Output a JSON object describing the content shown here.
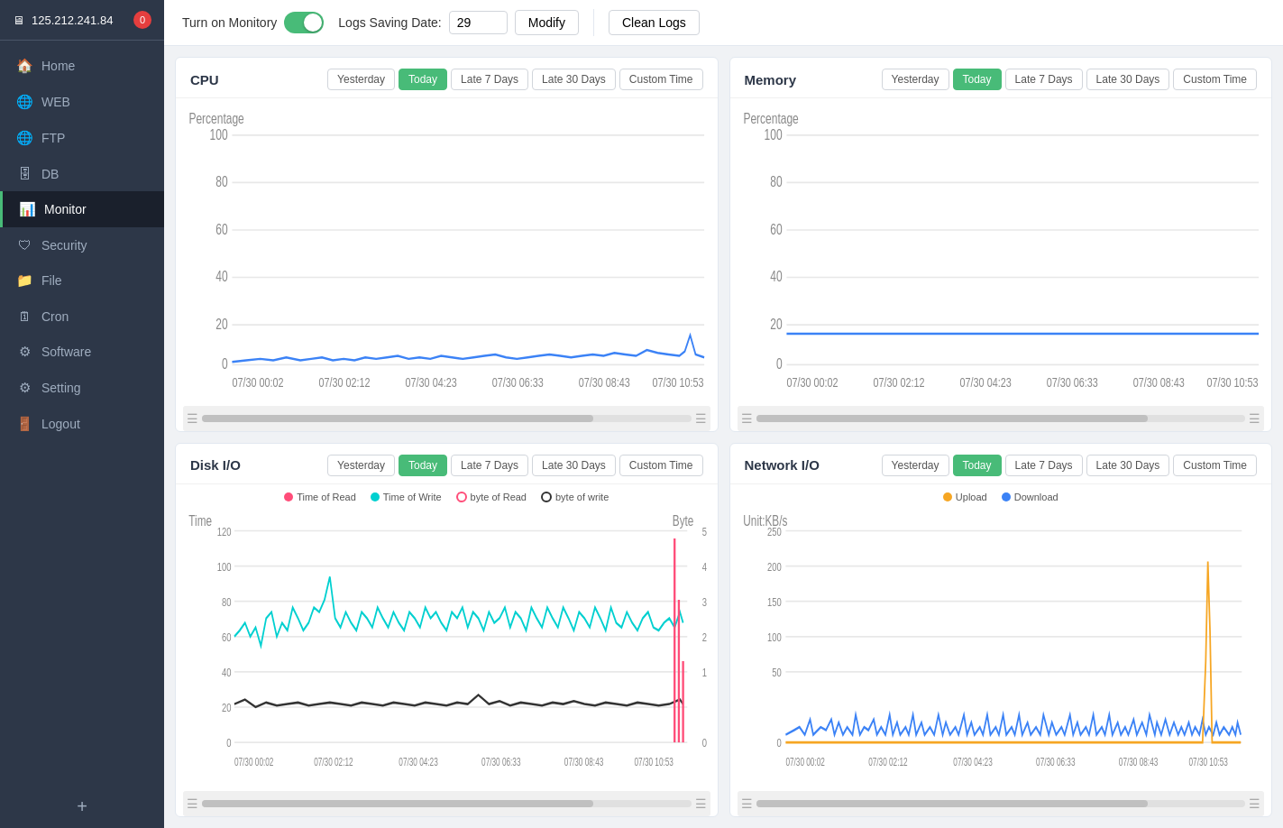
{
  "sidebar": {
    "ip": "125.212.241.84",
    "badge": "0",
    "items": [
      {
        "label": "Home",
        "icon": "🏠",
        "id": "home"
      },
      {
        "label": "WEB",
        "icon": "🌐",
        "id": "web"
      },
      {
        "label": "FTP",
        "icon": "🌐",
        "id": "ftp"
      },
      {
        "label": "DB",
        "icon": "🗄️",
        "id": "db"
      },
      {
        "label": "Monitor",
        "icon": "📊",
        "id": "monitor",
        "active": true
      },
      {
        "label": "Security",
        "icon": "🛡️",
        "id": "security"
      },
      {
        "label": "File",
        "icon": "📁",
        "id": "file"
      },
      {
        "label": "Cron",
        "icon": "🗓️",
        "id": "cron"
      },
      {
        "label": "Software",
        "icon": "⚙️",
        "id": "software"
      },
      {
        "label": "Setting",
        "icon": "⚙️",
        "id": "setting"
      },
      {
        "label": "Logout",
        "icon": "🚪",
        "id": "logout"
      }
    ]
  },
  "topbar": {
    "monitor_label": "Turn on Monitory",
    "logs_saving_label": "Logs Saving Date:",
    "logs_saving_value": "29",
    "modify_label": "Modify",
    "clean_logs_label": "Clean Logs"
  },
  "time_filters": [
    "Yesterday",
    "Today",
    "Late 7 Days",
    "Late 30 Days",
    "Custom Time"
  ],
  "panels": {
    "cpu": {
      "title": "CPU",
      "active_filter": "Today",
      "y_label": "Percentage",
      "y_ticks": [
        "100",
        "80",
        "60",
        "40",
        "20",
        "0"
      ],
      "x_ticks": [
        "07/30 00:02",
        "07/30 02:12",
        "07/30 04:23",
        "07/30 06:33",
        "07/30 08:43",
        "07/30 10:53"
      ]
    },
    "memory": {
      "title": "Memory",
      "active_filter": "Today",
      "y_label": "Percentage",
      "y_ticks": [
        "100",
        "80",
        "60",
        "40",
        "20",
        "0"
      ],
      "x_ticks": [
        "07/30 00:02",
        "07/30 02:12",
        "07/30 04:23",
        "07/30 06:33",
        "07/30 08:43",
        "07/30 10:53"
      ]
    },
    "disk": {
      "title": "Disk I/O",
      "active_filter": "Today",
      "y_label": "Time",
      "y2_label": "Byte",
      "y_ticks": [
        "120",
        "100",
        "80",
        "60",
        "40",
        "20",
        "0"
      ],
      "y2_ticks": [
        "5",
        "4",
        "3",
        "2",
        "1",
        "0"
      ],
      "x_ticks": [
        "07/30 00:02",
        "07/30 02:12",
        "07/30 04:23",
        "07/30 06:33",
        "07/30 08:43",
        "07/30 10:53"
      ],
      "legend": [
        {
          "label": "Time of Read",
          "color": "#ff4d79",
          "type": "dot"
        },
        {
          "label": "Time of Write",
          "color": "#00d0d0",
          "type": "dot"
        },
        {
          "label": "byte of Read",
          "color": "#ff4d79",
          "type": "circle"
        },
        {
          "label": "byte of write",
          "color": "#333",
          "type": "circle"
        }
      ]
    },
    "network": {
      "title": "Network I/O",
      "active_filter": "Today",
      "unit_label": "Unit:KB/s",
      "y_ticks": [
        "250",
        "200",
        "150",
        "100",
        "50",
        "0"
      ],
      "x_ticks": [
        "07/30 00:02",
        "07/30 02:12",
        "07/30 04:23",
        "07/30 06:33",
        "07/30 08:43",
        "07/30 10:53"
      ],
      "legend": [
        {
          "label": "Upload",
          "color": "#f6a623",
          "type": "dot"
        },
        {
          "label": "Download",
          "color": "#3b82f6",
          "type": "dot"
        }
      ]
    }
  }
}
